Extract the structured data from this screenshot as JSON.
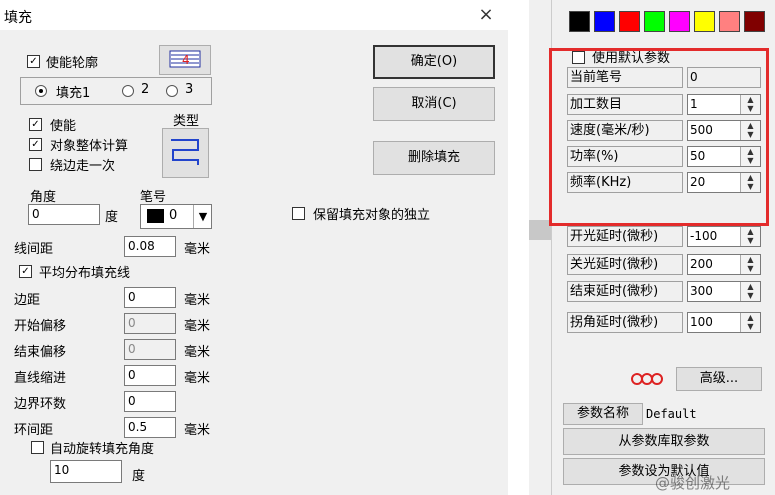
{
  "dialog": {
    "title": "填充",
    "close_glyph": "×",
    "enable_contour": {
      "label": "使能轮廓",
      "checked": true
    },
    "fill_radios": [
      {
        "label": "填充1",
        "selected": true
      },
      {
        "label": "2",
        "selected": false
      },
      {
        "label": "3",
        "selected": false
      }
    ],
    "enable": {
      "label": "使能",
      "checked": true
    },
    "object_calc": {
      "label": "对象整体计算",
      "checked": true
    },
    "border_once": {
      "label": "绕边走一次",
      "checked": false
    },
    "type_label": "类型",
    "angle_label": "角度",
    "angle_value": "0",
    "angle_unit": "度",
    "pen_label": "笔号",
    "pen_value": "0",
    "line_spacing": {
      "label": "线间距",
      "value": "0.08",
      "unit": "毫米"
    },
    "avg_distribute": {
      "label": "平均分布填充线",
      "checked": true
    },
    "margin": {
      "label": "边距",
      "value": "0",
      "unit": "毫米"
    },
    "start_offset": {
      "label": "开始偏移",
      "value": "0",
      "unit": "毫米"
    },
    "end_offset": {
      "label": "结束偏移",
      "value": "0",
      "unit": "毫米"
    },
    "line_indent": {
      "label": "直线缩进",
      "value": "0",
      "unit": "毫米"
    },
    "border_loops": {
      "label": "边界环数",
      "value": "0"
    },
    "loop_spacing": {
      "label": "环间距",
      "value": "0.5",
      "unit": "毫米"
    },
    "auto_rotate": {
      "label": "自动旋转填充角度",
      "checked": false
    },
    "rotate_value": "10",
    "rotate_unit": "度",
    "ok_button": "确定(O)",
    "cancel_button": "取消(C)",
    "delete_button": "删除填充",
    "keep_independent": {
      "label": "保留填充对象的独立",
      "checked": false
    }
  },
  "panel": {
    "colors": [
      "#000000",
      "#0000ff",
      "#ff0000",
      "#00ff00",
      "#ff00ff",
      "#ffff00",
      "#ff8080",
      "#800000"
    ],
    "use_default": {
      "label": "使用默认参数",
      "checked": false
    },
    "params": [
      {
        "label": "当前笔号",
        "value": "0",
        "spin": false
      },
      {
        "label": "加工数目",
        "value": "1",
        "spin": true
      },
      {
        "label": "速度(毫米/秒)",
        "value": "500",
        "spin": true
      },
      {
        "label": "功率(%)",
        "value": "50",
        "spin": true
      },
      {
        "label": "频率(KHz)",
        "value": "20",
        "spin": true
      },
      {
        "label": "开光延时(微秒)",
        "value": "-100",
        "spin": true
      },
      {
        "label": "关光延时(微秒)",
        "value": "200",
        "spin": true
      },
      {
        "label": "结束延时(微秒)",
        "value": "300",
        "spin": true
      },
      {
        "label": "拐角延时(微秒)",
        "value": "100",
        "spin": true
      }
    ],
    "advanced_button": "高级...",
    "param_name_label": "参数名称",
    "param_name_value": "Default",
    "load_from_lib": "从参数库取参数",
    "set_default": "参数设为默认值",
    "watermark": "@骏创激光"
  }
}
